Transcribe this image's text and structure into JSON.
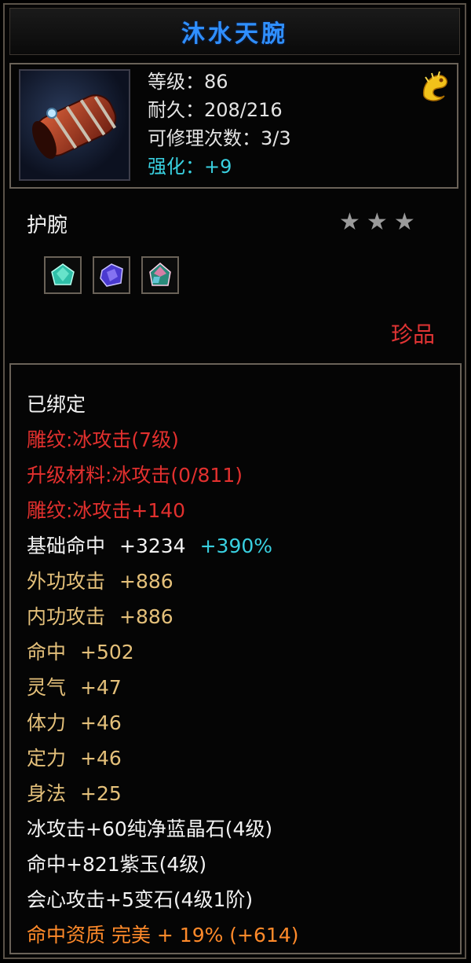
{
  "item": {
    "name": "沐水天腕",
    "level_label": "等级：86",
    "durability_label": "耐久：208/216",
    "repair_label": "可修理次数：3/3",
    "enhance_label": "强化：+9",
    "type": "护腕",
    "stars": 3,
    "quality": "珍品"
  },
  "details": {
    "bound": "已绑定",
    "engrave1": "雕纹:冰攻击(7级)",
    "upgrade_material": "升级材料:冰攻击(0/811)",
    "engrave2": "雕纹:冰攻击+140",
    "base_hit_label": "基础命中",
    "base_hit_value": "+3234",
    "base_hit_pct": "+390%",
    "ext_attack_label": "外功攻击",
    "ext_attack_value": "+886",
    "int_attack_label": "内功攻击",
    "int_attack_value": "+886",
    "hit_label": "命中",
    "hit_value": "+502",
    "spirit_label": "灵气",
    "spirit_value": "+47",
    "stamina_label": "体力",
    "stamina_value": "+46",
    "focus_label": "定力",
    "focus_value": "+46",
    "agility_label": "身法",
    "agility_value": "+25",
    "gem1": "冰攻击+60纯净蓝晶石(4级)",
    "gem2": "命中+821紫玉(4级)",
    "gem3": "会心攻击+5变石(4级1阶)",
    "aptitude": "命中资质 完美 + 19% (+614)"
  },
  "colors": {
    "title": "#2f8fff",
    "red": "#e2302e",
    "gold": "#e4c07a",
    "cyan": "#39d0e0",
    "orange": "#ff8a2a"
  },
  "icons": {
    "item": "bracer-icon",
    "badge": "golden-dragon-icon",
    "gems": [
      "green-gem-icon",
      "purple-gem-icon",
      "changestone-gem-icon"
    ]
  }
}
